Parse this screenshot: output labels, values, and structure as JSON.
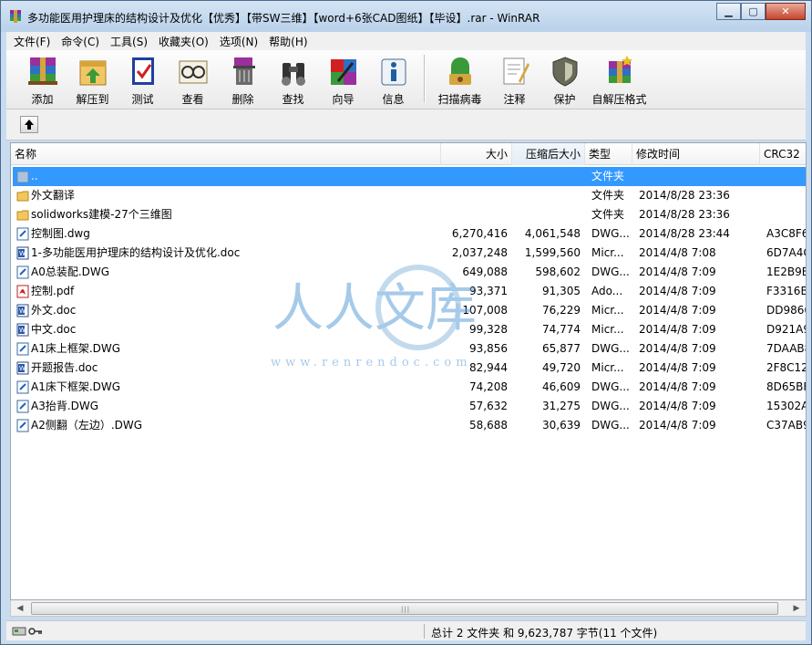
{
  "window": {
    "title": "多功能医用护理床的结构设计及优化【优秀】【带SW三维】【word+6张CAD图纸】【毕设】.rar - WinRAR"
  },
  "menu": [
    "文件(F)",
    "命令(C)",
    "工具(S)",
    "收藏夹(O)",
    "选项(N)",
    "帮助(H)"
  ],
  "toolbar": [
    {
      "label": "添加",
      "icon": "add-archive-icon"
    },
    {
      "label": "解压到",
      "icon": "extract-to-icon"
    },
    {
      "label": "测试",
      "icon": "test-icon"
    },
    {
      "label": "查看",
      "icon": "view-icon"
    },
    {
      "label": "删除",
      "icon": "delete-icon"
    },
    {
      "label": "查找",
      "icon": "find-icon"
    },
    {
      "label": "向导",
      "icon": "wizard-icon"
    },
    {
      "label": "信息",
      "icon": "info-icon"
    },
    {
      "label": "扫描病毒",
      "icon": "virus-scan-icon"
    },
    {
      "label": "注释",
      "icon": "comment-icon"
    },
    {
      "label": "保护",
      "icon": "protect-icon"
    },
    {
      "label": "自解压格式",
      "icon": "sfx-icon"
    }
  ],
  "columns": {
    "name": "名称",
    "size": "大小",
    "packed": "压缩后大小",
    "type": "类型",
    "modified": "修改时间",
    "crc": "CRC32"
  },
  "files": [
    {
      "name": "..",
      "size": "",
      "packed": "",
      "type": "文件夹",
      "modified": "",
      "crc": "",
      "icon": "parent-folder-icon"
    },
    {
      "name": "外文翻译",
      "size": "",
      "packed": "",
      "type": "文件夹",
      "modified": "2014/8/28 23:36",
      "crc": "",
      "icon": "folder-icon"
    },
    {
      "name": "solidworks建模-27个三维图",
      "size": "",
      "packed": "",
      "type": "文件夹",
      "modified": "2014/8/28 23:36",
      "crc": "",
      "icon": "folder-icon"
    },
    {
      "name": "控制图.dwg",
      "size": "6,270,416",
      "packed": "4,061,548",
      "type": "DWG...",
      "modified": "2014/8/28 23:44",
      "crc": "A3C8F6",
      "icon": "dwg-file-icon"
    },
    {
      "name": "1-多功能医用护理床的结构设计及优化.doc",
      "size": "2,037,248",
      "packed": "1,599,560",
      "type": "Micr...",
      "modified": "2014/4/8 7:08",
      "crc": "6D7A4C",
      "icon": "doc-file-icon"
    },
    {
      "name": "A0总装配.DWG",
      "size": "649,088",
      "packed": "598,602",
      "type": "DWG...",
      "modified": "2014/4/8 7:09",
      "crc": "1E2B9E",
      "icon": "dwg-file-icon"
    },
    {
      "name": "控制.pdf",
      "size": "93,371",
      "packed": "91,305",
      "type": "Ado...",
      "modified": "2014/4/8 7:09",
      "crc": "F3316BI",
      "icon": "pdf-file-icon"
    },
    {
      "name": "外文.doc",
      "size": "107,008",
      "packed": "76,229",
      "type": "Micr...",
      "modified": "2014/4/8 7:09",
      "crc": "DD9866",
      "icon": "doc-file-icon"
    },
    {
      "name": "中文.doc",
      "size": "99,328",
      "packed": "74,774",
      "type": "Micr...",
      "modified": "2014/4/8 7:09",
      "crc": "D921A9",
      "icon": "doc-file-icon"
    },
    {
      "name": "A1床上框架.DWG",
      "size": "93,856",
      "packed": "65,877",
      "type": "DWG...",
      "modified": "2014/4/8 7:09",
      "crc": "7DAAB8",
      "icon": "dwg-file-icon"
    },
    {
      "name": "开题报告.doc",
      "size": "82,944",
      "packed": "49,720",
      "type": "Micr...",
      "modified": "2014/4/8 7:09",
      "crc": "2F8C12I",
      "icon": "doc-file-icon"
    },
    {
      "name": "A1床下框架.DWG",
      "size": "74,208",
      "packed": "46,609",
      "type": "DWG...",
      "modified": "2014/4/8 7:09",
      "crc": "8D65BF",
      "icon": "dwg-file-icon"
    },
    {
      "name": "A3抬背.DWG",
      "size": "57,632",
      "packed": "31,275",
      "type": "DWG...",
      "modified": "2014/4/8 7:09",
      "crc": "15302A",
      "icon": "dwg-file-icon"
    },
    {
      "name": "A2侧翻（左边）.DWG",
      "size": "58,688",
      "packed": "30,639",
      "type": "DWG...",
      "modified": "2014/4/8 7:09",
      "crc": "C37AB9",
      "icon": "dwg-file-icon"
    }
  ],
  "status": {
    "summary": "总计 2 文件夹 和 9,623,787 字节(11 个文件)"
  },
  "watermark": {
    "text": "人人文库",
    "url": "www.renrendoc.com"
  },
  "colors": {
    "selection": "#3399ff",
    "titlebar": "#c9dcef"
  }
}
